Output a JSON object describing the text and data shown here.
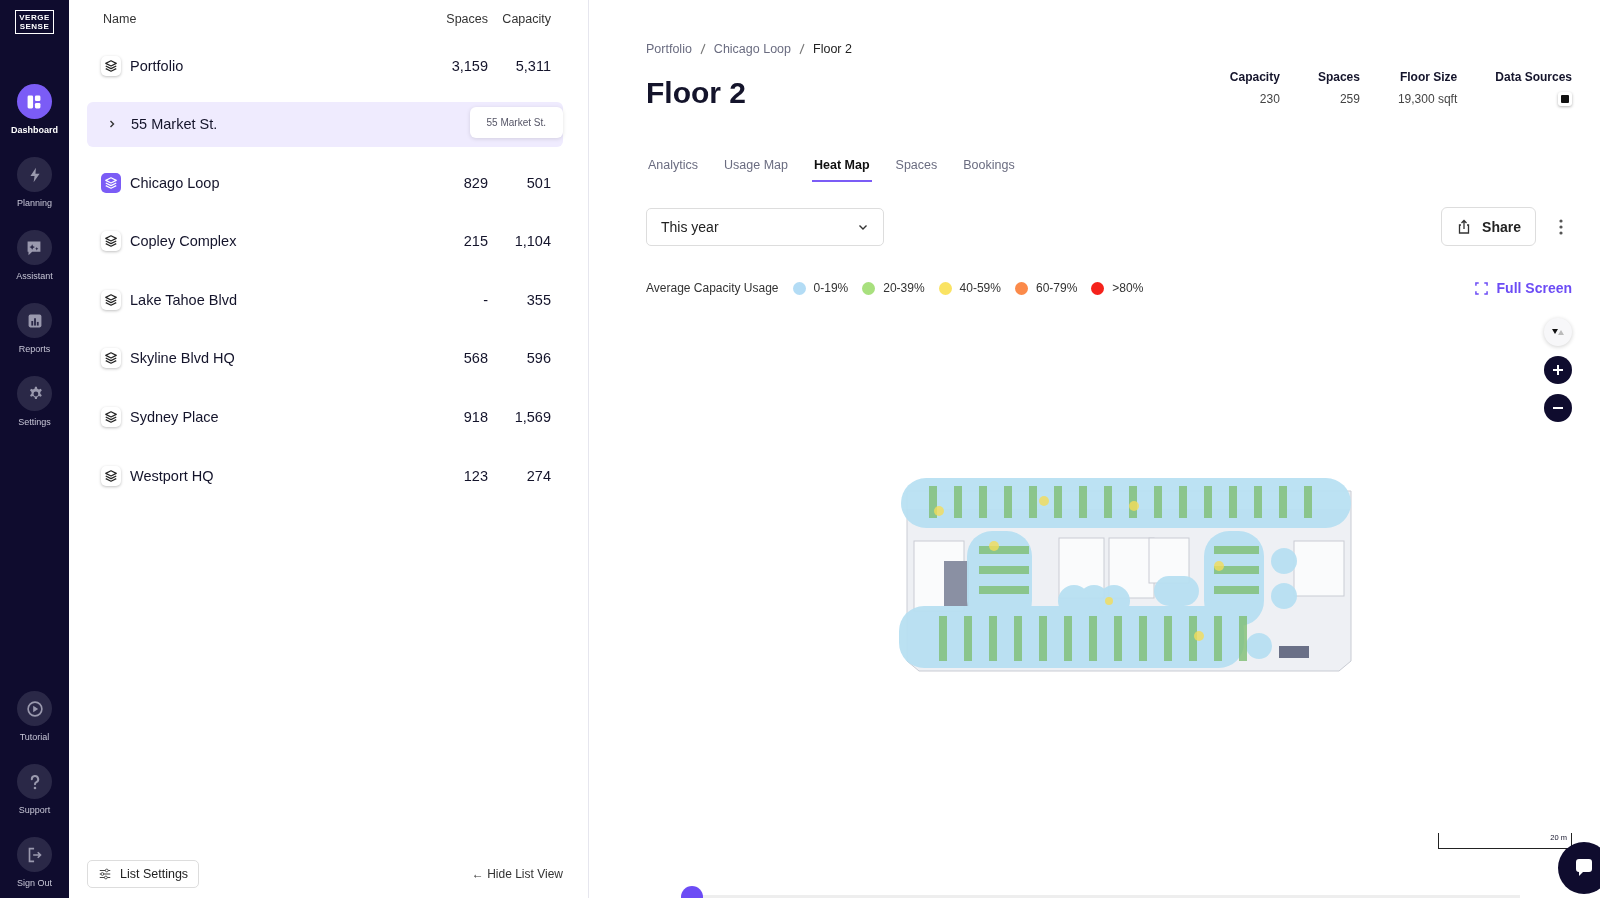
{
  "logo": {
    "line_1": "VERGE",
    "line_2": "SENSE"
  },
  "nav": {
    "top": [
      {
        "label": "Dashboard",
        "kind": "dashboard",
        "selected": true
      },
      {
        "label": "Planning",
        "kind": "planning",
        "selected": false
      },
      {
        "label": "Assistant",
        "kind": "assistant",
        "selected": false
      },
      {
        "label": "Reports",
        "kind": "reports",
        "selected": false
      },
      {
        "label": "Settings",
        "kind": "settings",
        "selected": false
      }
    ],
    "bottom": [
      {
        "label": "Tutorial",
        "kind": "tutorial",
        "selected": false
      },
      {
        "label": "Support",
        "kind": "support",
        "selected": false
      },
      {
        "label": "Sign Out",
        "kind": "signout",
        "selected": false
      }
    ]
  },
  "list": {
    "columns": [
      "Name",
      "Spaces",
      "Capacity"
    ],
    "rows": [
      {
        "kind": "layers",
        "name": "Portfolio",
        "spaces": "3,159",
        "capacity": "5,311",
        "selected": false,
        "highlighted": false
      },
      {
        "kind": "expandable",
        "name": "55 Market St.",
        "tooltip": "55 Market St.",
        "selected": false,
        "highlighted": true
      },
      {
        "kind": "layers",
        "name": "Chicago Loop",
        "spaces": "829",
        "capacity": "501",
        "selected": true,
        "highlighted": false
      },
      {
        "kind": "layers",
        "name": "Copley Complex",
        "spaces": "215",
        "capacity": "1,104",
        "selected": false,
        "highlighted": false
      },
      {
        "kind": "layers",
        "name": "Lake Tahoe Blvd",
        "spaces": "-",
        "capacity": "355",
        "selected": false,
        "highlighted": false
      },
      {
        "kind": "layers",
        "name": "Skyline Blvd HQ",
        "spaces": "568",
        "capacity": "596",
        "selected": false,
        "highlighted": false
      },
      {
        "kind": "layers",
        "name": "Sydney Place",
        "spaces": "918",
        "capacity": "1,569",
        "selected": false,
        "highlighted": false
      },
      {
        "kind": "layers",
        "name": "Westport HQ",
        "spaces": "123",
        "capacity": "274",
        "selected": false,
        "highlighted": false
      }
    ],
    "settings_button": "List Settings",
    "hide_link": "← Hide List View"
  },
  "breadcrumb": [
    "Portfolio",
    "Chicago Loop",
    "Floor 2"
  ],
  "title": "Floor 2",
  "stats": [
    {
      "label": "Capacity",
      "value": "230"
    },
    {
      "label": "Spaces",
      "value": "259"
    },
    {
      "label": "Floor Size",
      "value": "19,300 sqft"
    }
  ],
  "data_sources_label": "Data Sources",
  "tabs": [
    {
      "label": "Analytics",
      "selected": false
    },
    {
      "label": "Usage Map",
      "selected": false
    },
    {
      "label": "Heat Map",
      "selected": true
    },
    {
      "label": "Spaces",
      "selected": false
    },
    {
      "label": "Bookings",
      "selected": false
    }
  ],
  "period": {
    "value": "This year"
  },
  "share_button": "Share",
  "legend": {
    "title": "Average Capacity Usage",
    "items": [
      {
        "label": "0-19%",
        "color": "#b3dcf5"
      },
      {
        "label": "20-39%",
        "color": "#a8e07e"
      },
      {
        "label": "40-59%",
        "color": "#fae363"
      },
      {
        "label": "60-79%",
        "color": "#fb8a4a"
      },
      {
        "label": ">80%",
        "color": "#f5221b"
      }
    ]
  },
  "full_screen": "Full Screen",
  "scale_label": "20 m",
  "timeline": {
    "level": 0
  }
}
